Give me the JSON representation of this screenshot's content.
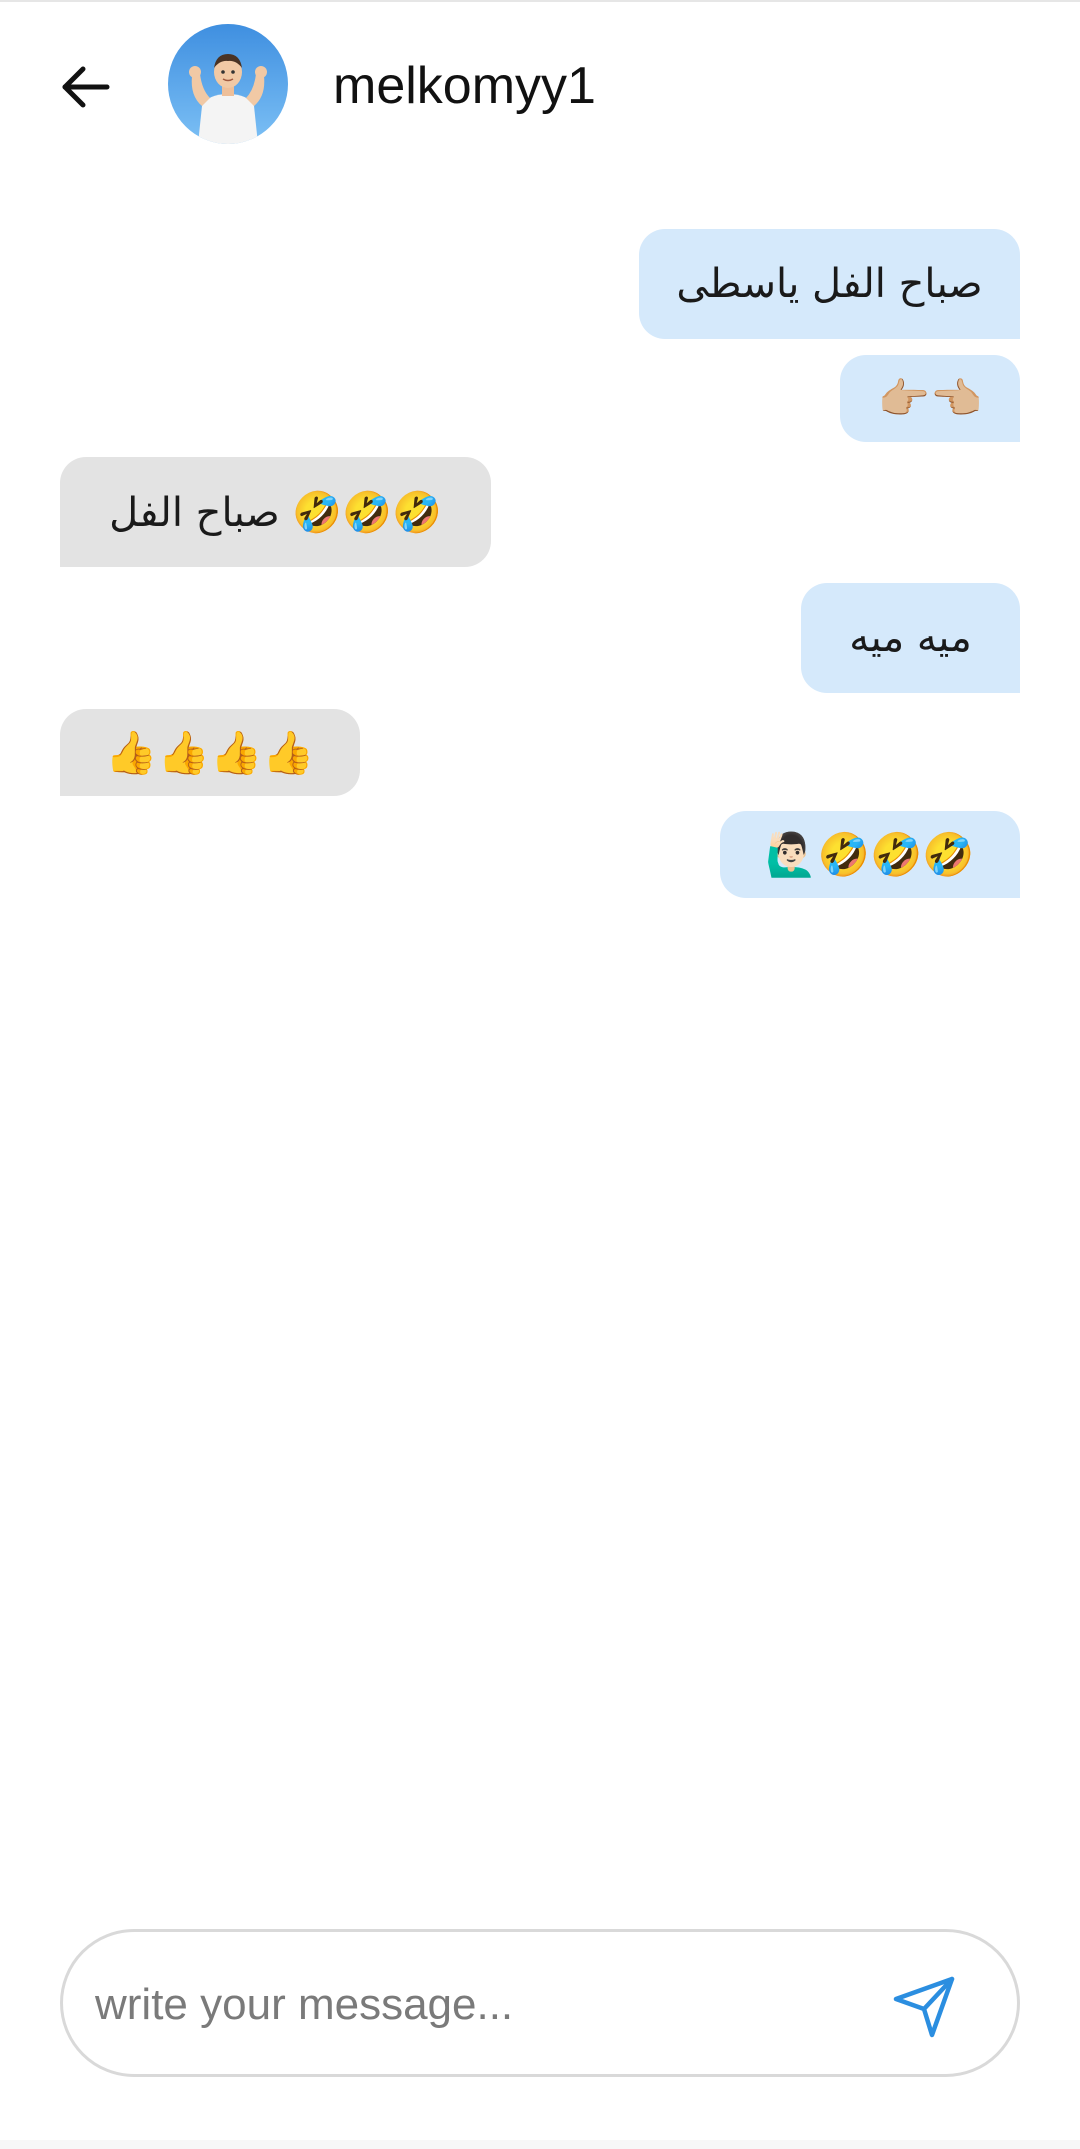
{
  "header": {
    "username": "melkomyy1"
  },
  "messages": [
    {
      "direction": "outgoing",
      "text": "صباح الفل ياسطى"
    },
    {
      "direction": "outgoing",
      "text": "👉🏼👈🏼"
    },
    {
      "direction": "incoming",
      "text": "صباح الفل 🤣🤣🤣"
    },
    {
      "direction": "outgoing",
      "text": "ميه ميه"
    },
    {
      "direction": "incoming",
      "text": "👍👍👍👍"
    },
    {
      "direction": "outgoing",
      "text": "🙋🏻‍♂️🤣🤣🤣"
    }
  ],
  "composer": {
    "placeholder": "write your message..."
  },
  "icons": {
    "back": "arrow-left-icon",
    "send": "paper-plane-icon"
  },
  "colors": {
    "outgoing_bubble": "#d5e9fb",
    "incoming_bubble": "#e3e3e3",
    "send_icon": "#2b8ee0"
  }
}
